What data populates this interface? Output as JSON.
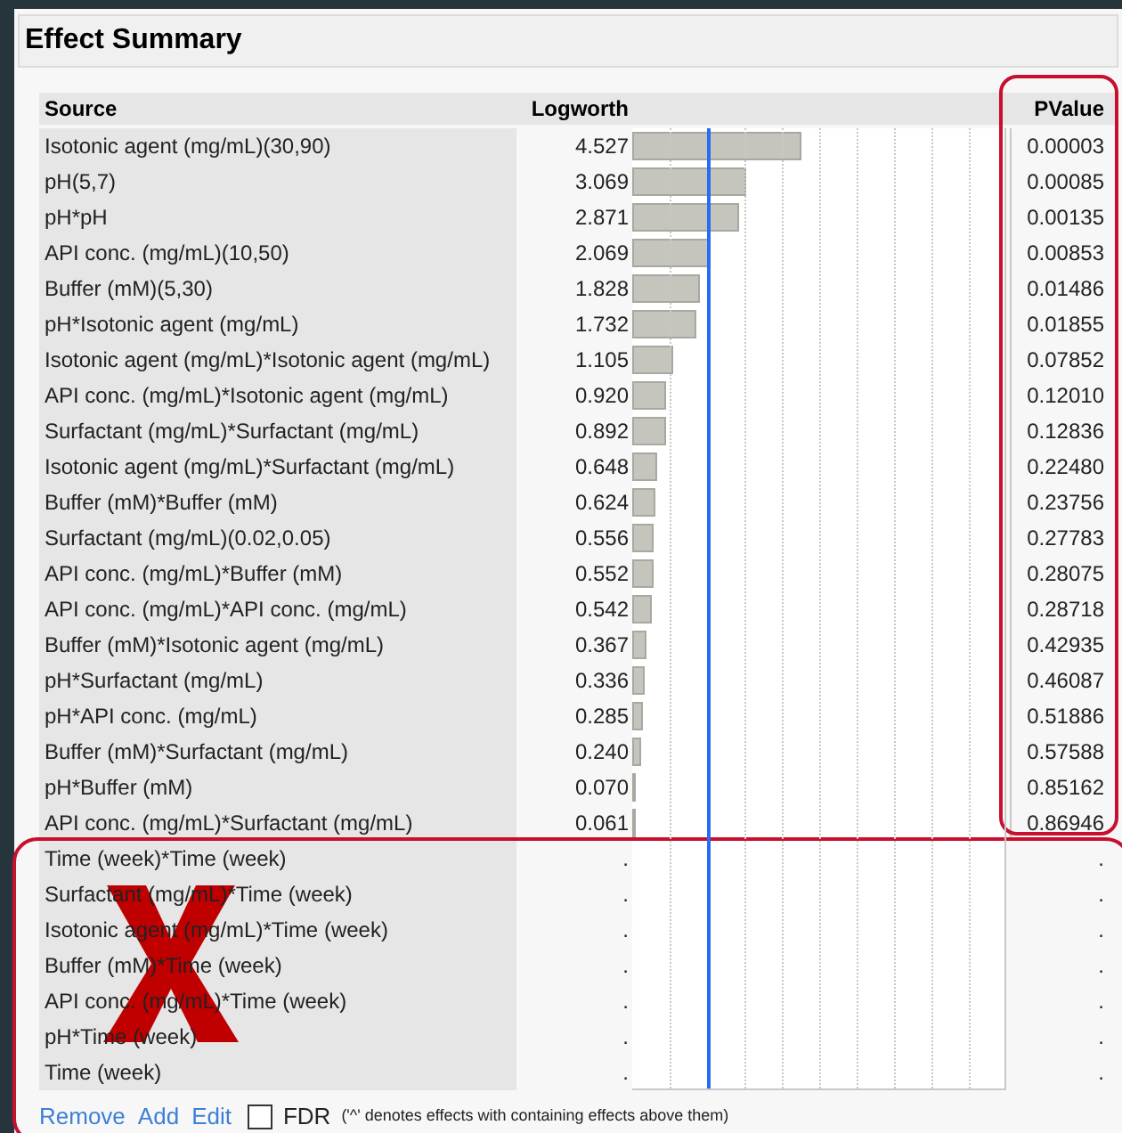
{
  "title": "Effect Summary",
  "columns": [
    "Source",
    "Logworth",
    "PValue"
  ],
  "rows": [
    {
      "source": "Isotonic agent (mg/mL)(30,90)",
      "logworth": "4.527",
      "level": 0.4527,
      "pvalue": "0.00003"
    },
    {
      "source": "pH(5,7)",
      "logworth": "3.069",
      "level": 0.3069,
      "pvalue": "0.00085"
    },
    {
      "source": "pH*pH",
      "logworth": "2.871",
      "level": 0.2871,
      "pvalue": "0.00135"
    },
    {
      "source": "API conc. (mg/mL)(10,50)",
      "logworth": "2.069",
      "level": 0.2069,
      "pvalue": "0.00853"
    },
    {
      "source": "Buffer (mM)(5,30)",
      "logworth": "1.828",
      "level": 0.1828,
      "pvalue": "0.01486"
    },
    {
      "source": "pH*Isotonic agent (mg/mL)",
      "logworth": "1.732",
      "level": 0.1732,
      "pvalue": "0.01855"
    },
    {
      "source": "Isotonic agent (mg/mL)*Isotonic agent (mg/mL)",
      "logworth": "1.105",
      "level": 0.1105,
      "pvalue": "0.07852"
    },
    {
      "source": "API conc. (mg/mL)*Isotonic agent (mg/mL)",
      "logworth": "0.920",
      "level": 0.092,
      "pvalue": "0.12010"
    },
    {
      "source": "Surfactant (mg/mL)*Surfactant (mg/mL)",
      "logworth": "0.892",
      "level": 0.0892,
      "pvalue": "0.12836"
    },
    {
      "source": "Isotonic agent (mg/mL)*Surfactant (mg/mL)",
      "logworth": "0.648",
      "level": 0.0648,
      "pvalue": "0.22480"
    },
    {
      "source": "Buffer (mM)*Buffer (mM)",
      "logworth": "0.624",
      "level": 0.0624,
      "pvalue": "0.23756"
    },
    {
      "source": "Surfactant (mg/mL)(0.02,0.05)",
      "logworth": "0.556",
      "level": 0.0556,
      "pvalue": "0.27783"
    },
    {
      "source": "API conc. (mg/mL)*Buffer (mM)",
      "logworth": "0.552",
      "level": 0.0552,
      "pvalue": "0.28075"
    },
    {
      "source": "API conc. (mg/mL)*API conc. (mg/mL)",
      "logworth": "0.542",
      "level": 0.0542,
      "pvalue": "0.28718"
    },
    {
      "source": "Buffer (mM)*Isotonic agent (mg/mL)",
      "logworth": "0.367",
      "level": 0.0367,
      "pvalue": "0.42935"
    },
    {
      "source": "pH*Surfactant (mg/mL)",
      "logworth": "0.336",
      "level": 0.0336,
      "pvalue": "0.46087"
    },
    {
      "source": "pH*API conc. (mg/mL)",
      "logworth": "0.285",
      "level": 0.0285,
      "pvalue": "0.51886"
    },
    {
      "source": "Buffer (mM)*Surfactant (mg/mL)",
      "logworth": "0.240",
      "level": 0.024,
      "pvalue": "0.57588"
    },
    {
      "source": "pH*Buffer (mM)",
      "logworth": "0.070",
      "level": 0.007,
      "pvalue": "0.85162"
    },
    {
      "source": "API conc. (mg/mL)*Surfactant (mg/mL)",
      "logworth": "0.061",
      "level": 0.0061,
      "pvalue": "0.86946"
    },
    {
      "source": "Time (week)*Time (week)",
      "logworth": ".",
      "pvalue": "."
    },
    {
      "source": "Surfactant (mg/mL)*Time (week)",
      "logworth": ".",
      "pvalue": "."
    },
    {
      "source": "Isotonic agent (mg/mL)*Time (week)",
      "logworth": ".",
      "pvalue": "."
    },
    {
      "source": "Buffer (mM)*Time (week)",
      "logworth": ".",
      "pvalue": "."
    },
    {
      "source": "API conc. (mg/mL)*Time (week)",
      "logworth": ".",
      "pvalue": "."
    },
    {
      "source": "pH*Time (week)",
      "logworth": ".",
      "pvalue": "."
    },
    {
      "source": "Time (week)",
      "logworth": ".",
      "pvalue": "."
    }
  ],
  "footer": {
    "links": [
      "Remove",
      "Add",
      "Edit"
    ],
    "fdr": {
      "label": "FDR",
      "checked": false
    },
    "note": "('^' denotes effects with containing effects above them)"
  }
}
